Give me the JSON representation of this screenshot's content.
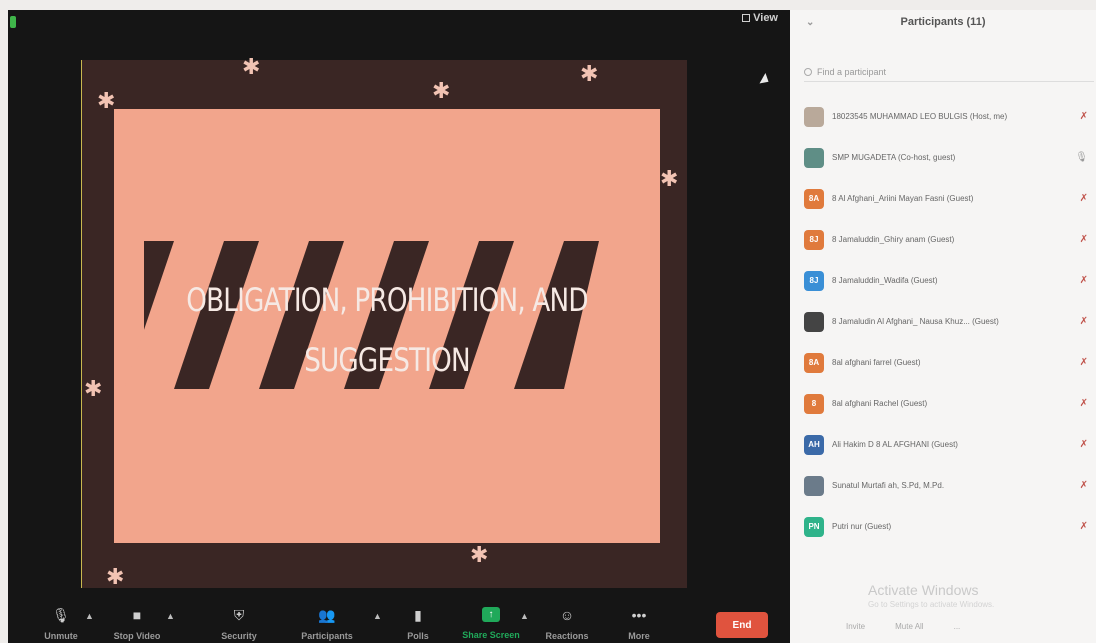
{
  "view": {
    "label": "View"
  },
  "slide": {
    "title_line1": "OBLIGATION, PROHIBITION, AND",
    "title_line2": "SUGGESTION"
  },
  "toolbar": {
    "items": [
      {
        "label": "Unmute",
        "icon": "mic-muted-icon"
      },
      {
        "label": "Stop Video",
        "icon": "video-camera-icon"
      },
      {
        "label": "Security",
        "icon": "shield-icon"
      },
      {
        "label": "Participants",
        "icon": "participants-icon",
        "count": "11"
      },
      {
        "label": "Polls",
        "icon": "polls-icon"
      },
      {
        "label": "Share Screen",
        "icon": "share-screen-icon"
      },
      {
        "label": "Reactions",
        "icon": "reactions-icon"
      },
      {
        "label": "More",
        "icon": "more-icon"
      }
    ],
    "end_label": "End"
  },
  "panel": {
    "title": "Participants (11)",
    "search_placeholder": "Find a participant",
    "participants": [
      {
        "initials": "",
        "name": "18023545 MUHAMMAD LEO BULGIS (Host, me)",
        "avatar_color": "#b9a99a",
        "mic": "muted"
      },
      {
        "initials": "",
        "name": "SMP MUGADETA (Co-host, guest)",
        "avatar_color": "#5f8e86",
        "mic": "on"
      },
      {
        "initials": "8A",
        "name": "8 Al Afghani_Ariini Mayan Fasni (Guest)",
        "avatar_color": "#e07a3c",
        "mic": "muted"
      },
      {
        "initials": "8J",
        "name": "8 Jamaluddin_Ghiry anam (Guest)",
        "avatar_color": "#e07a3c",
        "mic": "muted"
      },
      {
        "initials": "8J",
        "name": "8 Jamaluddin_Wadifa (Guest)",
        "avatar_color": "#3a8fd6",
        "mic": "muted"
      },
      {
        "initials": "",
        "name": "8 Jamaludin Al Afghani_ Nausa Khuz... (Guest)",
        "avatar_color": "#444",
        "mic": "muted"
      },
      {
        "initials": "8A",
        "name": "8al afghani farrel (Guest)",
        "avatar_color": "#e07a3c",
        "mic": "muted"
      },
      {
        "initials": "8",
        "name": "8al afghani Rachel (Guest)",
        "avatar_color": "#e07a3c",
        "mic": "muted"
      },
      {
        "initials": "AH",
        "name": "Ali Hakim D 8 AL AFGHANI (Guest)",
        "avatar_color": "#3b6aa8",
        "mic": "muted"
      },
      {
        "initials": "",
        "name": "Sunatul Murtafi ah, S.Pd, M.Pd.",
        "avatar_color": "#6b7b8a",
        "mic": "muted"
      },
      {
        "initials": "PN",
        "name": "Putri nur (Guest)",
        "avatar_color": "#2fb38a",
        "mic": "muted"
      }
    ],
    "watermark_title": "Activate Windows",
    "watermark_sub": "Go to Settings to activate Windows.",
    "footer": [
      "Invite",
      "Mute All",
      "..."
    ]
  }
}
